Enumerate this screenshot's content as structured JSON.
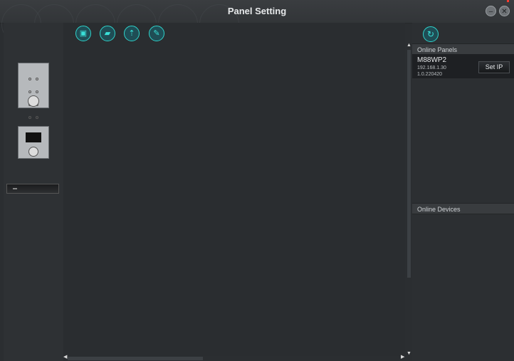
{
  "window": {
    "title": "Panel Setting",
    "minimize_icon": "minimize-icon",
    "close_icon": "close-icon"
  },
  "toolbar": {
    "buttons": [
      {
        "icon": "save-icon",
        "glyph": "▣"
      },
      {
        "icon": "open-folder-icon",
        "glyph": "▰"
      },
      {
        "icon": "upload-icon",
        "glyph": "⇡"
      },
      {
        "icon": "edit-icon",
        "glyph": "✎"
      }
    ]
  },
  "devices": [
    {
      "icon": "keypad-panel-icon"
    },
    {
      "icon": "display-panel-icon"
    },
    {
      "icon": "rack-device-icon"
    }
  ],
  "right_panel": {
    "refresh_icon": "refresh-icon",
    "refresh_glyph": "↻",
    "online_panels_label": "Online Panels",
    "online_devices_label": "Online Devices",
    "panels": [
      {
        "name": "M88WP2",
        "ip": "192.168.1.30",
        "version": "1.0.220420",
        "button_label": "Set IP"
      }
    ]
  },
  "colors": {
    "accent": "#2fd4cc",
    "background": "#2b2e31",
    "panel_row": "#1e2023"
  }
}
